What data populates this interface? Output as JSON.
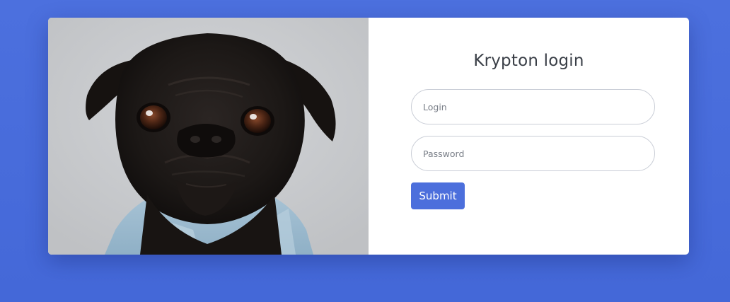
{
  "login_card": {
    "title": "Krypton login",
    "login_field": {
      "value": "",
      "placeholder": "Login"
    },
    "password_field": {
      "value": "",
      "placeholder": "Password"
    },
    "submit_label": "Submit",
    "photo_subject": "pug-dog-photo"
  },
  "colors": {
    "background": "#4a6fdc",
    "button": "#4c6fdc",
    "card": "#ffffff"
  }
}
